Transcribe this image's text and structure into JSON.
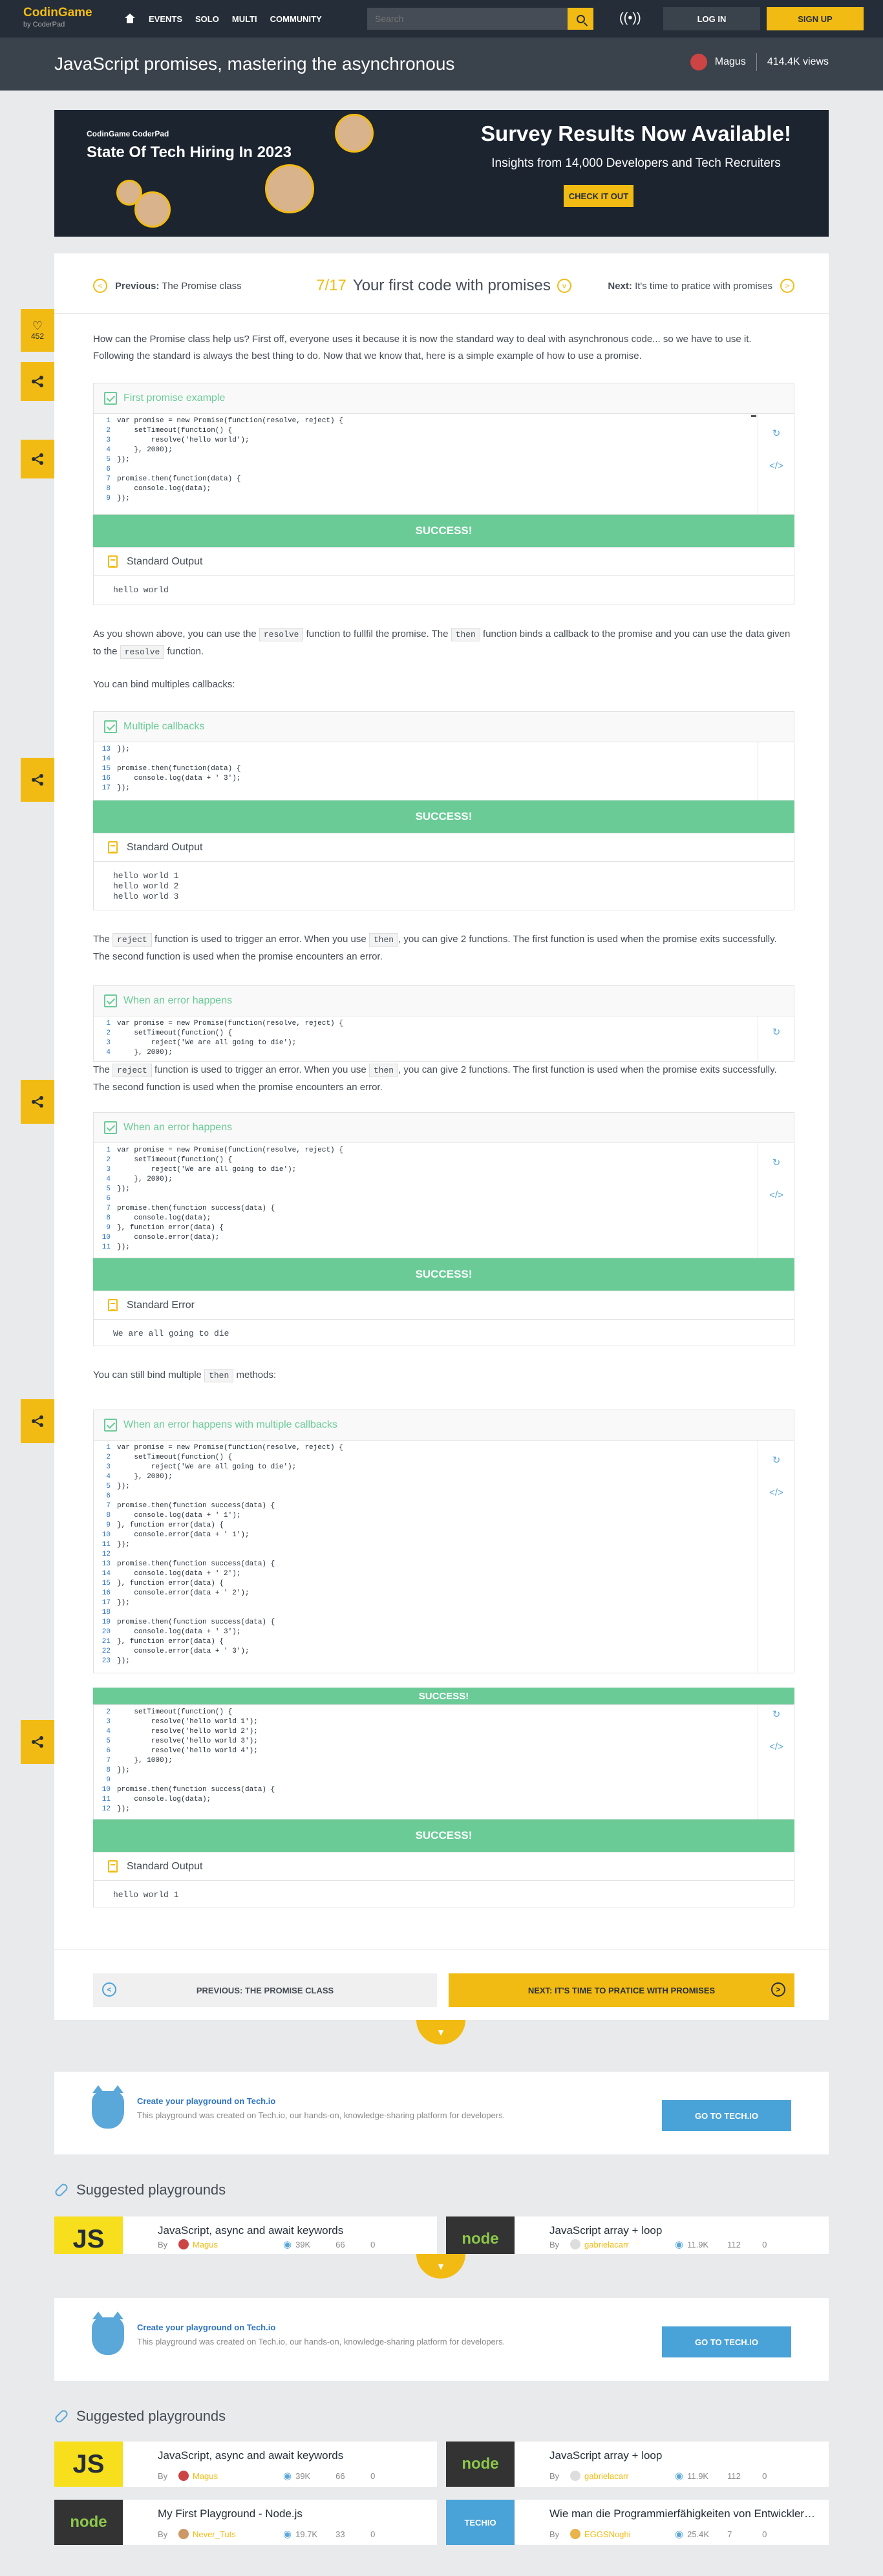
{
  "header": {
    "logo_main": "CodinGame",
    "logo_sub": "by CoderPad",
    "nav": [
      "EVENTS",
      "SOLO",
      "MULTI",
      "COMMUNITY"
    ],
    "search_placeholder": "Search",
    "login": "LOG IN",
    "signup": "SIGN UP"
  },
  "page": {
    "title": "JavaScript promises, mastering the asynchronous",
    "author": "Magus",
    "views": "414.4K views"
  },
  "ad": {
    "brand": "CodinGame  CoderPad",
    "left_title": "State Of Tech Hiring In 2023",
    "headline": "Survey Results Now Available!",
    "sub": "Insights from 14,000 Developers and Tech Recruiters",
    "cta": "CHECK IT OUT"
  },
  "rail": {
    "likes": "452"
  },
  "lesson_nav": {
    "prev_label": "Previous:",
    "prev": "The Promise class",
    "page": "7/17",
    "current": "Your first code with promises",
    "next_label": "Next:",
    "next": "It's time to pratice with promises"
  },
  "content": {
    "p1": "How can the Promise class help us? First off, everyone uses it because it is now the standard way to deal with asynchronous code... so we have to use it. Following the standard is always the best thing to do. Now that we know that, here is a simple example of how to use a promise.",
    "p2a": "As you shown above, you can use the",
    "p2b": "function to fullfil the promise. The",
    "p2c": "function binds a callback to the promise and you can use the data given to the",
    "p2d": "function.",
    "resolve": "resolve",
    "then": "then",
    "reject": "reject",
    "p3": "You can bind multiples callbacks:",
    "p4a": "The",
    "p4b": "function is used to trigger an error. When you use",
    "p4c": ", you can give 2 functions. The first function is used when the promise exits successfully. The second function is used when the promise encounters an error.",
    "p5a": "You can still bind multiple",
    "p5b": "methods:"
  },
  "blocks": {
    "b1": {
      "title": "First promise example",
      "code": [
        "var promise = new Promise(function(resolve, reject) {",
        "    setTimeout(function() {",
        "        resolve('hello world');",
        "    }, 2000);",
        "});",
        "",
        "promise.then(function(data) {",
        "    console.log(data);",
        "});"
      ],
      "status": "SUCCESS!",
      "out_title": "Standard Output",
      "output": "hello world"
    },
    "b2": {
      "title": "Multiple callbacks",
      "code_lines": [
        "13",
        "14",
        "15",
        "16",
        "17"
      ],
      "code": [
        "});",
        "",
        "promise.then(function(data) {",
        "    console.log(data + ' 3');",
        "});"
      ],
      "status": "SUCCESS!",
      "out_title": "Standard Output",
      "output": "hello world 1\nhello world 2\nhello world 3"
    },
    "b3": {
      "title": "When an error happens",
      "code": [
        "var promise = new Promise(function(resolve, reject) {",
        "    setTimeout(function() {",
        "        reject('We are all going to die');",
        "    }, 2000);"
      ]
    },
    "b4": {
      "title": "When an error happens",
      "code": [
        "var promise = new Promise(function(resolve, reject) {",
        "    setTimeout(function() {",
        "        reject('We are all going to die');",
        "    }, 2000);",
        "});",
        "",
        "promise.then(function success(data) {",
        "    console.log(data);",
        "}, function error(data) {",
        "    console.error(data);",
        "});"
      ],
      "status": "SUCCESS!",
      "out_title": "Standard Error",
      "output": "We are all going to die"
    },
    "b5": {
      "title": "When an error happens with multiple callbacks",
      "code": [
        "var promise = new Promise(function(resolve, reject) {",
        "    setTimeout(function() {",
        "        reject('We are all going to die');",
        "    }, 2000);",
        "});",
        "",
        "promise.then(function success(data) {",
        "    console.log(data + ' 1');",
        "}, function error(data) {",
        "    console.error(data + ' 1');",
        "});",
        "",
        "promise.then(function success(data) {",
        "    console.log(data + ' 2');",
        "}, function error(data) {",
        "    console.error(data + ' 2');",
        "});",
        "",
        "promise.then(function success(data) {",
        "    console.log(data + ' 3');",
        "}, function error(data) {",
        "    console.error(data + ' 3');",
        "});"
      ],
      "status": "SUCCESS!"
    },
    "b6": {
      "code_lines": [
        "2",
        "3",
        "4",
        "5",
        "6",
        "7",
        "8",
        "9",
        "10",
        "11",
        "12"
      ],
      "code": [
        "    setTimeout(function() {",
        "        resolve('hello world 1');",
        "        resolve('hello world 2');",
        "        resolve('hello world 3');",
        "        resolve('hello world 4');",
        "    }, 1000);",
        "});",
        "",
        "promise.then(function success(data) {",
        "    console.log(data);",
        "});"
      ],
      "status": "SUCCESS!",
      "out_title": "Standard Output",
      "output": "hello world 1"
    }
  },
  "bottom_nav": {
    "prev": "PREVIOUS: THE PROMISE CLASS",
    "next": "NEXT: IT'S TIME TO PRATICE WITH PROMISES"
  },
  "techio": {
    "title": "Create your playground on Tech.io",
    "desc": "This playground was created on Tech.io, our hands-on, knowledge-sharing platform for developers.",
    "button": "GO TO TECH.IO"
  },
  "suggested": {
    "heading": "Suggested playgrounds",
    "by": "By",
    "items": [
      {
        "thumb": "JS",
        "title": "JavaScript, async and await keywords",
        "user": "Magus",
        "views": "39K",
        "c1": "66",
        "c2": "0"
      },
      {
        "thumb": "node",
        "title": "JavaScript array + loop",
        "user": "gabrielacarr",
        "views": "11.9K",
        "c1": "112",
        "c2": "0"
      },
      {
        "thumb": "node",
        "title": "My First Playground - Node.js",
        "user": "Never_Tuts",
        "views": "19.7K",
        "c1": "33",
        "c2": "0"
      },
      {
        "thumb": "TECHIO",
        "title": "Wie man die Programmierfähigkeiten von Entwicklern testet",
        "user": "EGGSNoghi",
        "views": "25.4K",
        "c1": "7",
        "c2": "0"
      }
    ]
  },
  "colors": {
    "accent": "#f2bb13",
    "success": "#6acb97",
    "dark": "#252e38",
    "link": "#4aa3d8"
  }
}
